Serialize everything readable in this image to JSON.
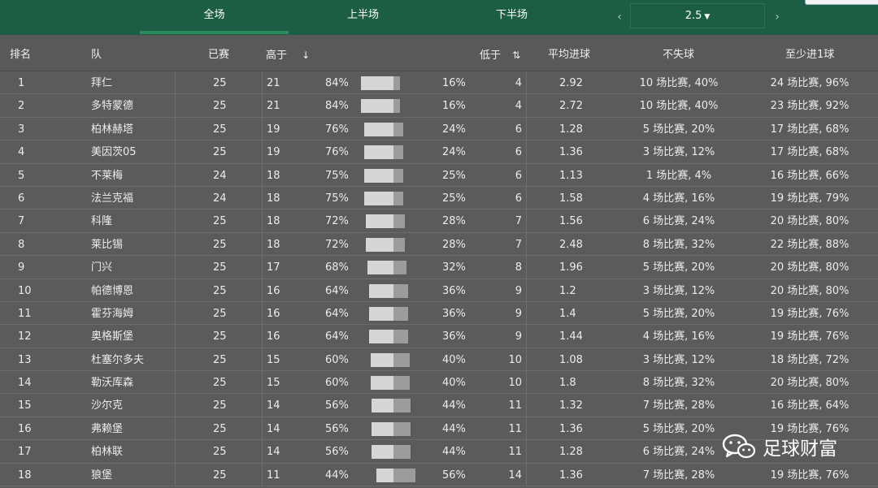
{
  "tabs": [
    {
      "label": "全场",
      "active": true
    },
    {
      "label": "上半场",
      "active": false
    },
    {
      "label": "下半场",
      "active": false
    }
  ],
  "line_selector": {
    "value": "2.5",
    "prev_icon": "‹",
    "next_icon": "›"
  },
  "columns": {
    "rank": "排名",
    "team": "队",
    "played": "已赛",
    "over": "高于",
    "over_sort": "↓",
    "under": "低于",
    "under_sort": "⇅",
    "avg_goals": "平均进球",
    "clean_sheet": "不失球",
    "at_least_one": "至少进1球"
  },
  "rows": [
    {
      "rank": "1",
      "team": "拜仁",
      "played": "25",
      "over_n": "21",
      "over_pct": "84%",
      "under_pct": "16%",
      "under_n": "4",
      "avg": "2.92",
      "clean": "10 场比赛, 40%",
      "one": "24 场比赛, 96%",
      "over_frac": 0.84
    },
    {
      "rank": "2",
      "team": "多特蒙德",
      "played": "25",
      "over_n": "21",
      "over_pct": "84%",
      "under_pct": "16%",
      "under_n": "4",
      "avg": "2.72",
      "clean": "10 场比赛, 40%",
      "one": "23 场比赛, 92%",
      "over_frac": 0.84
    },
    {
      "rank": "3",
      "team": "柏林赫塔",
      "played": "25",
      "over_n": "19",
      "over_pct": "76%",
      "under_pct": "24%",
      "under_n": "6",
      "avg": "1.28",
      "clean": "5 场比赛, 20%",
      "one": "17 场比赛, 68%",
      "over_frac": 0.76
    },
    {
      "rank": "4",
      "team": "美因茨05",
      "played": "25",
      "over_n": "19",
      "over_pct": "76%",
      "under_pct": "24%",
      "under_n": "6",
      "avg": "1.36",
      "clean": "3 场比赛, 12%",
      "one": "17 场比赛, 68%",
      "over_frac": 0.76
    },
    {
      "rank": "5",
      "team": "不莱梅",
      "played": "24",
      "over_n": "18",
      "over_pct": "75%",
      "under_pct": "25%",
      "under_n": "6",
      "avg": "1.13",
      "clean": "1 场比赛, 4%",
      "one": "16 场比赛, 66%",
      "over_frac": 0.75
    },
    {
      "rank": "6",
      "team": "法兰克福",
      "played": "24",
      "over_n": "18",
      "over_pct": "75%",
      "under_pct": "25%",
      "under_n": "6",
      "avg": "1.58",
      "clean": "4 场比赛, 16%",
      "one": "19 场比赛, 79%",
      "over_frac": 0.75
    },
    {
      "rank": "7",
      "team": "科隆",
      "played": "25",
      "over_n": "18",
      "over_pct": "72%",
      "under_pct": "28%",
      "under_n": "7",
      "avg": "1.56",
      "clean": "6 场比赛, 24%",
      "one": "20 场比赛, 80%",
      "over_frac": 0.72
    },
    {
      "rank": "8",
      "team": "莱比锡",
      "played": "25",
      "over_n": "18",
      "over_pct": "72%",
      "under_pct": "28%",
      "under_n": "7",
      "avg": "2.48",
      "clean": "8 场比赛, 32%",
      "one": "22 场比赛, 88%",
      "over_frac": 0.72
    },
    {
      "rank": "9",
      "team": "门兴",
      "played": "25",
      "over_n": "17",
      "over_pct": "68%",
      "under_pct": "32%",
      "under_n": "8",
      "avg": "1.96",
      "clean": "5 场比赛, 20%",
      "one": "20 场比赛, 80%",
      "over_frac": 0.68
    },
    {
      "rank": "10",
      "team": "帕德博恩",
      "played": "25",
      "over_n": "16",
      "over_pct": "64%",
      "under_pct": "36%",
      "under_n": "9",
      "avg": "1.2",
      "clean": "3 场比赛, 12%",
      "one": "20 场比赛, 80%",
      "over_frac": 0.64
    },
    {
      "rank": "11",
      "team": "霍芬海姆",
      "played": "25",
      "over_n": "16",
      "over_pct": "64%",
      "under_pct": "36%",
      "under_n": "9",
      "avg": "1.4",
      "clean": "5 场比赛, 20%",
      "one": "19 场比赛, 76%",
      "over_frac": 0.64
    },
    {
      "rank": "12",
      "team": "奥格斯堡",
      "played": "25",
      "over_n": "16",
      "over_pct": "64%",
      "under_pct": "36%",
      "under_n": "9",
      "avg": "1.44",
      "clean": "4 场比赛, 16%",
      "one": "19 场比赛, 76%",
      "over_frac": 0.64
    },
    {
      "rank": "13",
      "team": "杜塞尔多夫",
      "played": "25",
      "over_n": "15",
      "over_pct": "60%",
      "under_pct": "40%",
      "under_n": "10",
      "avg": "1.08",
      "clean": "3 场比赛, 12%",
      "one": "18 场比赛, 72%",
      "over_frac": 0.6
    },
    {
      "rank": "14",
      "team": "勒沃库森",
      "played": "25",
      "over_n": "15",
      "over_pct": "60%",
      "under_pct": "40%",
      "under_n": "10",
      "avg": "1.8",
      "clean": "8 场比赛, 32%",
      "one": "20 场比赛, 80%",
      "over_frac": 0.6
    },
    {
      "rank": "15",
      "team": "沙尔克",
      "played": "25",
      "over_n": "14",
      "over_pct": "56%",
      "under_pct": "44%",
      "under_n": "11",
      "avg": "1.32",
      "clean": "7 场比赛, 28%",
      "one": "16 场比赛, 64%",
      "over_frac": 0.56
    },
    {
      "rank": "16",
      "team": "弗赖堡",
      "played": "25",
      "over_n": "14",
      "over_pct": "56%",
      "under_pct": "44%",
      "under_n": "11",
      "avg": "1.36",
      "clean": "5 场比赛, 20%",
      "one": "19 场比赛, 76%",
      "over_frac": 0.56
    },
    {
      "rank": "17",
      "team": "柏林联",
      "played": "25",
      "over_n": "14",
      "over_pct": "56%",
      "under_pct": "44%",
      "under_n": "11",
      "avg": "1.28",
      "clean": "6 场比赛, 24%",
      "one": "",
      "over_frac": 0.56
    },
    {
      "rank": "18",
      "team": "狼堡",
      "played": "25",
      "over_n": "11",
      "over_pct": "44%",
      "under_pct": "56%",
      "under_n": "14",
      "avg": "1.36",
      "clean": "7 场比赛, 28%",
      "one": "19 场比赛, 76%",
      "over_frac": 0.44
    }
  ],
  "watermark": {
    "text": "足球财富",
    "icon": "wechat-icon"
  },
  "colors": {
    "topbar": "#1c5e43",
    "tab_underline": "#2b8a5e",
    "bar_over": "#d6d6d6",
    "bar_under": "#9c9c9c"
  }
}
